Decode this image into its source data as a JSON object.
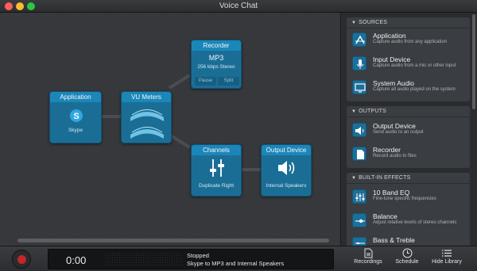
{
  "window": {
    "title": "Voice Chat"
  },
  "nodes": {
    "application": {
      "title": "Application",
      "label": "Skype"
    },
    "vu": {
      "title": "VU Meters"
    },
    "recorder": {
      "title": "Recorder",
      "format": "MP3",
      "quality": "256 kbps Stereo",
      "pause": "Pause",
      "split": "Split"
    },
    "channels": {
      "title": "Channels",
      "label": "Duplicate Right"
    },
    "output": {
      "title": "Output Device",
      "label": "Internal Speakers"
    }
  },
  "sidebar": {
    "sources": {
      "header": "SOURCES",
      "items": [
        {
          "title": "Application",
          "desc": "Capture audio from any application",
          "icon": "application-icon"
        },
        {
          "title": "Input Device",
          "desc": "Capture audio from a mic or other input",
          "icon": "microphone-icon"
        },
        {
          "title": "System Audio",
          "desc": "Capture all audio played on the system",
          "icon": "monitor-icon"
        }
      ]
    },
    "outputs": {
      "header": "OUTPUTS",
      "items": [
        {
          "title": "Output Device",
          "desc": "Send audio to an output",
          "icon": "speaker-icon"
        },
        {
          "title": "Recorder",
          "desc": "Record audio to files",
          "icon": "file-icon"
        }
      ]
    },
    "effects": {
      "header": "BUILT-IN EFFECTS",
      "items": [
        {
          "title": "10 Band EQ",
          "desc": "Fine-tune specific frequencies",
          "icon": "equalizer-icon"
        },
        {
          "title": "Balance",
          "desc": "Adjust relative levels of stereo channels",
          "icon": "balance-icon"
        },
        {
          "title": "Bass & Treble",
          "desc": "",
          "icon": "bass-treble-icon"
        }
      ]
    }
  },
  "bottombar": {
    "timer": "0:00",
    "status": "Stopped",
    "detail": "Skype to MP3 and Internal Speakers",
    "recordings": "Recordings",
    "schedule": "Schedule",
    "hide_library": "Hide Library"
  },
  "colors": {
    "node": "#1a6e96",
    "node_header": "#1c86b8",
    "record": "#c4262a"
  }
}
